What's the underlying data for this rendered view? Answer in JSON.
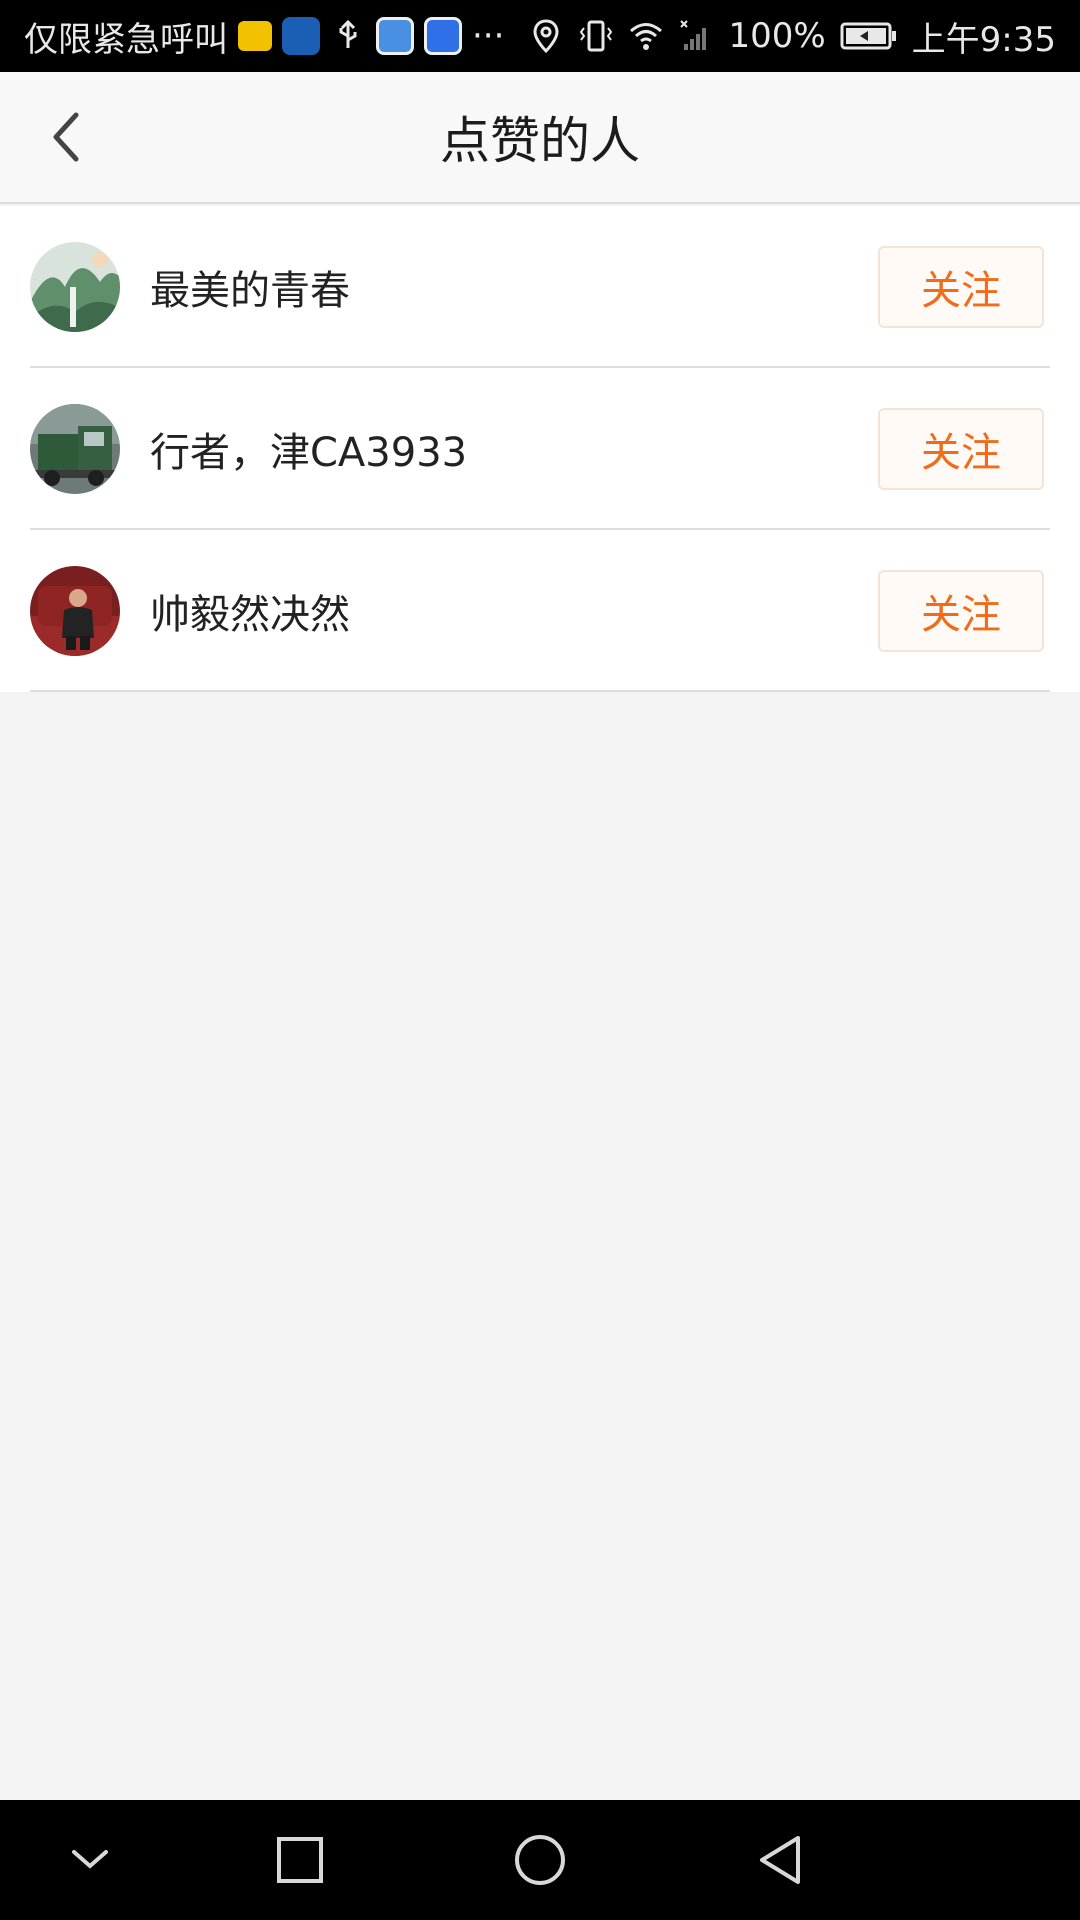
{
  "status_bar": {
    "carrier_text": "仅限紧急呼叫",
    "more_text": "···",
    "battery": "100%",
    "time": "上午9:35",
    "icons": [
      "taxi-app-icon",
      "shield-app-icon",
      "usb-icon",
      "maps-app-icon",
      "baidu-app-icon",
      "location-icon",
      "vibrate-icon",
      "wifi-icon",
      "signal-icon",
      "battery-icon"
    ]
  },
  "header": {
    "title": "点赞的人",
    "back_icon": "chevron-left-icon"
  },
  "users": [
    {
      "name": "最美的青春",
      "follow_label": "关注",
      "avatar": "landscape-painting-avatar"
    },
    {
      "name": "行者，津CA3933",
      "follow_label": "关注",
      "avatar": "truck-avatar"
    },
    {
      "name": "帅毅然决然",
      "follow_label": "关注",
      "avatar": "person-on-sofa-avatar"
    }
  ],
  "colors": {
    "accent": "#ef6c1a",
    "background": "#f4f4f4",
    "header_bg": "#f8f8f8"
  },
  "nav_bar": {
    "icons": [
      "nav-hide-icon",
      "nav-recents-icon",
      "nav-home-icon",
      "nav-back-icon"
    ]
  }
}
